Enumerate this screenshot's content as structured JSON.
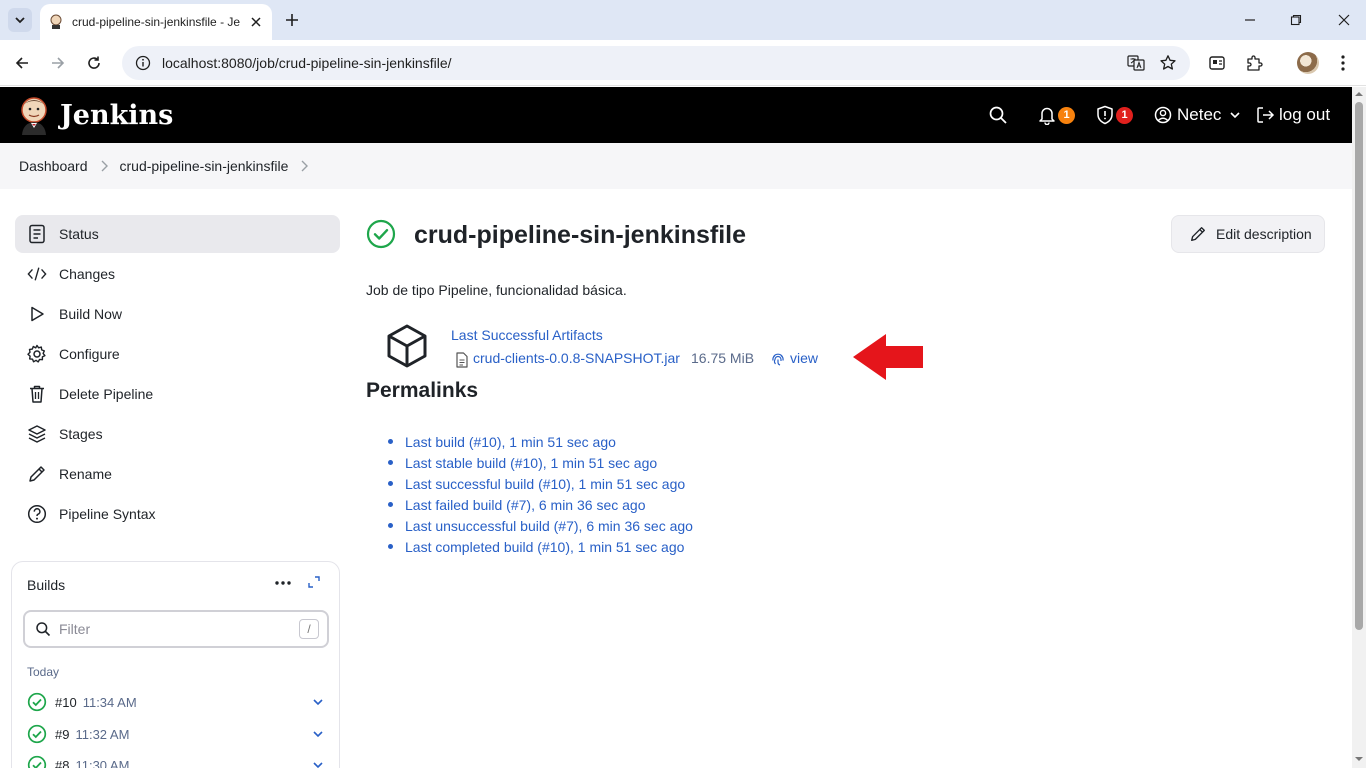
{
  "browser": {
    "tab_title": "crud-pipeline-sin-jenkinsfile - Je",
    "url": "localhost:8080/job/crud-pipeline-sin-jenkinsfile/"
  },
  "header": {
    "brand": "Jenkins",
    "notifications_count": "1",
    "security_count": "1",
    "user": "Netec",
    "logout": "log out",
    "notification_badge_color": "#f7820e",
    "security_badge_color": "#e0201d"
  },
  "breadcrumb": {
    "items": [
      "Dashboard",
      "crud-pipeline-sin-jenkinsfile"
    ]
  },
  "sidebar": {
    "items": [
      {
        "label": "Status",
        "icon": "status-icon"
      },
      {
        "label": "Changes",
        "icon": "code-icon"
      },
      {
        "label": "Build Now",
        "icon": "play-icon"
      },
      {
        "label": "Configure",
        "icon": "gear-icon"
      },
      {
        "label": "Delete Pipeline",
        "icon": "trash-icon"
      },
      {
        "label": "Stages",
        "icon": "layers-icon"
      },
      {
        "label": "Rename",
        "icon": "pencil-icon"
      },
      {
        "label": "Pipeline Syntax",
        "icon": "help-icon"
      }
    ]
  },
  "builds": {
    "title": "Builds",
    "filter_placeholder": "Filter",
    "filter_shortcut": "/",
    "group": "Today",
    "rows": [
      {
        "number": "#10",
        "time": "11:34 AM"
      },
      {
        "number": "#9",
        "time": "11:32 AM"
      },
      {
        "number": "#8",
        "time": "11:30 AM"
      }
    ]
  },
  "main": {
    "title": "crud-pipeline-sin-jenkinsfile",
    "edit_description": "Edit description",
    "description": "Job de tipo Pipeline, funcionalidad básica.",
    "artifacts": {
      "title": "Last Successful Artifacts",
      "file": "crud-clients-0.0.8-SNAPSHOT.jar",
      "size": "16.75 MiB",
      "view": "view"
    },
    "permalinks_title": "Permalinks",
    "permalinks": [
      "Last build (#10), 1 min 51 sec ago",
      "Last stable build (#10), 1 min 51 sec ago",
      "Last successful build (#10), 1 min 51 sec ago",
      "Last failed build (#7), 6 min 36 sec ago",
      "Last unsuccessful build (#7), 6 min 36 sec ago",
      "Last completed build (#10), 1 min 51 sec ago"
    ]
  },
  "colors": {
    "link": "#2960c7",
    "success": "#1ea64b",
    "annotation_arrow": "#e5151b"
  }
}
